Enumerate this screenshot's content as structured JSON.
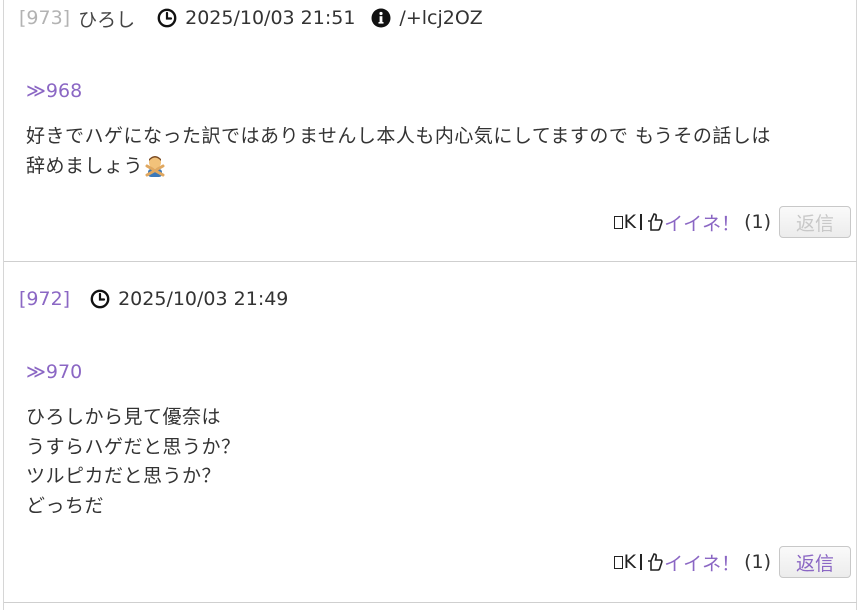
{
  "posts": [
    {
      "number": "[973]",
      "author": "ひろし",
      "date": "2025/10/03 21:51",
      "ident": "/+lcj2OZ",
      "anchor": "≫968",
      "lines": [
        "好きでハゲになった訳ではありませんし本人も内心気にしてますので もうその話しは",
        "辞めましょう"
      ],
      "emoji": "person-gesturing-no",
      "ok_label": "K",
      "like_label": "イイネ！",
      "like_count": "(1)",
      "reply_label": "返信",
      "reply_enabled": false
    },
    {
      "number": "[972]",
      "date": "2025/10/03 21:49",
      "anchor": "≫970",
      "lines": [
        "ひろしから見て優奈は",
        "うすらハゲだと思うか？",
        "ツルピカだと思うか？",
        "どっちだ"
      ],
      "ok_label": "K",
      "like_label": "イイネ！",
      "like_count": "(1)",
      "reply_label": "返信",
      "reply_enabled": true
    }
  ],
  "colors": {
    "accent": "#8b67c4",
    "muted_number": "#b3b3b3",
    "text": "#333333",
    "divider": "#cfcfcf"
  }
}
